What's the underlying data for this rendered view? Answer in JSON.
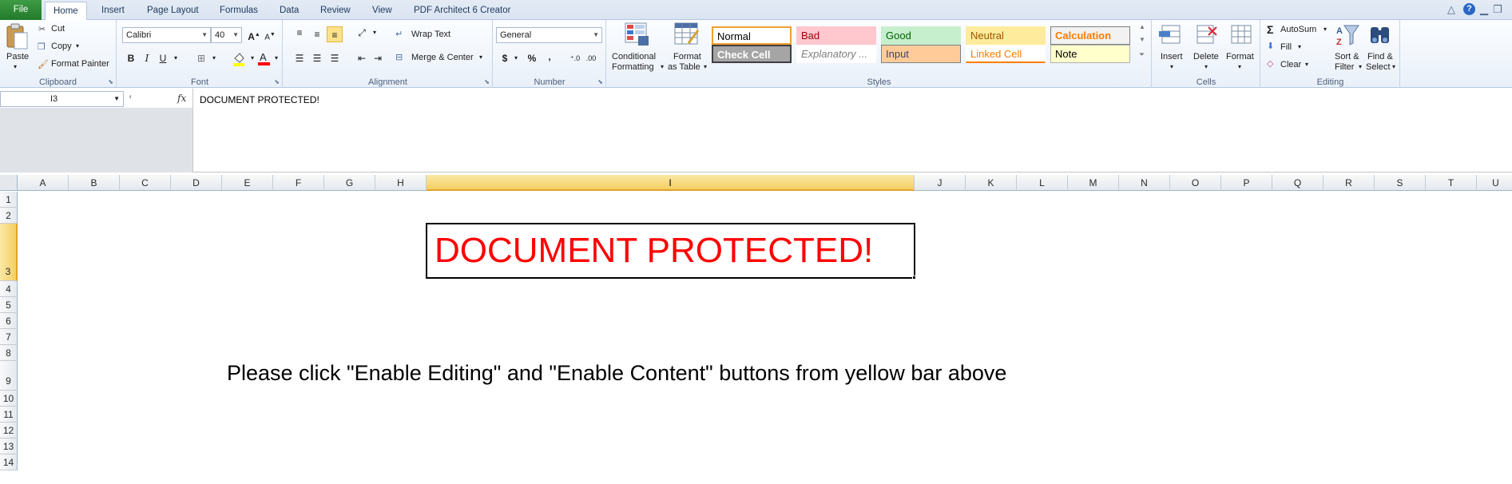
{
  "tabs": [
    "File",
    "Home",
    "Insert",
    "Page Layout",
    "Formulas",
    "Data",
    "Review",
    "View",
    "PDF Architect 6 Creator"
  ],
  "active_tab": "Home",
  "clipboard": {
    "paste": "Paste",
    "cut": "Cut",
    "copy": "Copy",
    "format_painter": "Format Painter",
    "label": "Clipboard"
  },
  "font": {
    "name": "Calibri",
    "size": "40",
    "bold": "B",
    "italic": "I",
    "underline": "U",
    "label": "Font"
  },
  "alignment": {
    "wrap_text": "Wrap Text",
    "merge_center": "Merge & Center",
    "label": "Alignment"
  },
  "number": {
    "format": "General",
    "currency": "$",
    "percent": "%",
    "comma": ",",
    "label": "Number"
  },
  "styles": {
    "conditional_formatting": [
      "Conditional",
      "Formatting"
    ],
    "format_as_table": [
      "Format",
      "as Table"
    ],
    "cells": [
      {
        "text": "Normal",
        "bg": "#ffffff",
        "fg": "#000000",
        "border": "#f0a030"
      },
      {
        "text": "Bad",
        "bg": "#ffc7ce",
        "fg": "#9c0006",
        "border": "#ffc7ce"
      },
      {
        "text": "Good",
        "bg": "#c6efce",
        "fg": "#006100",
        "border": "#c6efce"
      },
      {
        "text": "Neutral",
        "bg": "#ffeb9c",
        "fg": "#9c5700",
        "border": "#ffeb9c"
      },
      {
        "text": "Calculation",
        "bg": "#f2f2f2",
        "fg": "#fa7d00",
        "border": "#7f7f7f"
      },
      {
        "text": "Check Cell",
        "bg": "#a5a5a5",
        "fg": "#ffffff",
        "border": "#3f3f3f"
      },
      {
        "text": "Explanatory ...",
        "bg": "#ffffff",
        "fg": "#7f7f7f",
        "border": "#ffffff"
      },
      {
        "text": "Input",
        "bg": "#ffcc99",
        "fg": "#3f3f76",
        "border": "#7f7f7f"
      },
      {
        "text": "Linked Cell",
        "bg": "#ffffff",
        "fg": "#fa7d00",
        "border": "#ffffff"
      },
      {
        "text": "Note",
        "bg": "#ffffcc",
        "fg": "#000000",
        "border": "#b2b2b2"
      }
    ],
    "label": "Styles"
  },
  "cells_group": {
    "insert": "Insert",
    "delete": "Delete",
    "format": "Format",
    "label": "Cells"
  },
  "editing": {
    "autosum": "AutoSum",
    "fill": "Fill",
    "clear": "Clear",
    "sort_filter": [
      "Sort &",
      "Filter"
    ],
    "find_select": [
      "Find &",
      "Select"
    ],
    "label": "Editing"
  },
  "formula_bar": {
    "name_box": "I3",
    "fx": "fx",
    "content": "DOCUMENT PROTECTED!"
  },
  "columns": [
    "A",
    "B",
    "C",
    "D",
    "E",
    "F",
    "G",
    "H",
    "I",
    "J",
    "K",
    "L",
    "M",
    "N",
    "O",
    "P",
    "Q",
    "R",
    "S",
    "T",
    "U"
  ],
  "selected_column": "I",
  "rows": [
    "1",
    "2",
    "3",
    "4",
    "5",
    "6",
    "7",
    "8",
    "9",
    "10",
    "11",
    "12",
    "13",
    "14"
  ],
  "selected_row": "3",
  "sheet": {
    "protected_text": "DOCUMENT PROTECTED!",
    "instruction_text": "Please click \"Enable Editing\" and \"Enable Content\" buttons from yellow bar above"
  },
  "colors": {
    "accent": "#217a2a",
    "protected_text": "#ff0000",
    "selection": "#f3cf62"
  }
}
